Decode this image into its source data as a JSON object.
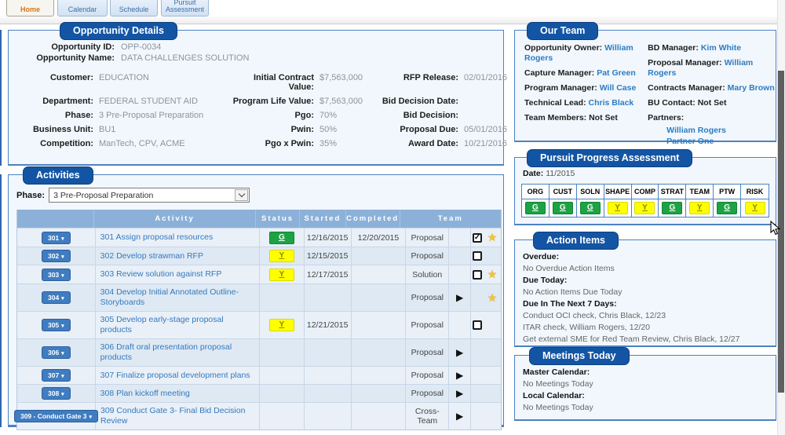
{
  "colors": {
    "accent": "#1355a4",
    "panel_border": "#4d82c2",
    "status_green": "#1ca344",
    "status_yellow": "#ffff00",
    "link": "#3579bd",
    "active_tab_text": "#d4731a"
  },
  "icons": {
    "caret_down": "▾",
    "play": "▶",
    "star": "★",
    "check": "✓",
    "chevron_down": "select-chevron"
  },
  "tabs": [
    {
      "label": "Home",
      "active": true
    },
    {
      "label": "Calendar",
      "active": false
    },
    {
      "label": "Schedule",
      "active": false
    },
    {
      "label": "Pursuit Assessment",
      "active": false
    }
  ],
  "opportunity_details": {
    "title": "Opportunity Details",
    "top_fields": [
      {
        "label": "Opportunity ID:",
        "value": "OPP-0034"
      },
      {
        "label": "Opportunity Name:",
        "value": "DATA CHALLENGES SOLUTION"
      }
    ],
    "col1": [
      {
        "label": "Customer:",
        "value": "EDUCATION"
      },
      {
        "label": "Department:",
        "value": "FEDERAL STUDENT AID"
      },
      {
        "label": "Phase:",
        "value": "3 Pre-Proposal Preparation"
      },
      {
        "label": "Business Unit:",
        "value": "BU1"
      },
      {
        "label": "Competition:",
        "value": "ManTech, CPV, ACME"
      }
    ],
    "col2": [
      {
        "label": "Initial Contract Value:",
        "value": "$7,563,000"
      },
      {
        "label": "Program Life Value:",
        "value": "$7,563,000"
      },
      {
        "label": "Pgo:",
        "value": "70%"
      },
      {
        "label": "Pwin:",
        "value": "50%"
      },
      {
        "label": "Pgo x Pwin:",
        "value": "35%"
      }
    ],
    "col3": [
      {
        "label": "RFP Release:",
        "value": "02/01/2016"
      },
      {
        "label": "Bid Decision Date:",
        "value": ""
      },
      {
        "label": "Bid Decision:",
        "value": ""
      },
      {
        "label": "Proposal Due:",
        "value": "05/01/2016"
      },
      {
        "label": "Award Date:",
        "value": "10/21/2016"
      }
    ]
  },
  "activities": {
    "title": "Activities",
    "phase_label": "Phase:",
    "phase_value": "3 Pre-Proposal Preparation",
    "columns": [
      "",
      "Activity",
      "Status",
      "Started",
      "Completed",
      "Team"
    ],
    "rows": [
      {
        "button": "301",
        "name": "301 Assign proposal resources",
        "status": "G",
        "started": "12/16/2015",
        "completed": "12/20/2015",
        "team": "Proposal",
        "play": false,
        "checkbox": "checked",
        "star": true
      },
      {
        "button": "302",
        "name": "302 Develop strawman RFP",
        "status": "Y",
        "started": "12/15/2015",
        "completed": "",
        "team": "Proposal",
        "play": false,
        "checkbox": "empty",
        "star": false
      },
      {
        "button": "303",
        "name": "303 Review solution against RFP",
        "status": "Y",
        "started": "12/17/2015",
        "completed": "",
        "team": "Solution",
        "play": false,
        "checkbox": "empty",
        "star": true
      },
      {
        "button": "304",
        "name": "304 Develop Initial Annotated Outline- Storyboards",
        "status": "",
        "started": "",
        "completed": "",
        "team": "Proposal",
        "play": true,
        "checkbox": null,
        "star": true
      },
      {
        "button": "305",
        "name": "305 Develop early-stage proposal products",
        "status": "Y",
        "started": "12/21/2015",
        "completed": "",
        "team": "Proposal",
        "play": false,
        "checkbox": "empty",
        "star": false
      },
      {
        "button": "306",
        "name": "306 Draft oral presentation proposal products",
        "status": "",
        "started": "",
        "completed": "",
        "team": "Proposal",
        "play": true,
        "checkbox": null,
        "star": false
      },
      {
        "button": "307",
        "name": "307 Finalize proposal development plans",
        "status": "",
        "started": "",
        "completed": "",
        "team": "Proposal",
        "play": true,
        "checkbox": null,
        "star": false
      },
      {
        "button": "308",
        "name": "308 Plan kickoff meeting",
        "status": "",
        "started": "",
        "completed": "",
        "team": "Proposal",
        "play": true,
        "checkbox": null,
        "star": false
      },
      {
        "button": "309 - Conduct Gate 3",
        "name": "309 Conduct Gate 3- Final Bid Decision Review",
        "status": "",
        "started": "",
        "completed": "",
        "team": "Cross-Team",
        "play": true,
        "checkbox": null,
        "star": false
      }
    ]
  },
  "our_team": {
    "title": "Our Team",
    "left": [
      {
        "label": "Opportunity Owner:",
        "value": "William Rogers",
        "link": true
      },
      {
        "label": "Capture Manager:",
        "value": "Pat Green",
        "link": true
      },
      {
        "label": "Program Manager:",
        "value": "Will Case",
        "link": true
      },
      {
        "label": "Technical Lead:",
        "value": "Chris Black",
        "link": true
      },
      {
        "label": "Team Members:",
        "value": "Not Set",
        "link": false
      }
    ],
    "right": [
      {
        "label": "BD Manager:",
        "value": "Kim White",
        "link": true
      },
      {
        "label": "Proposal Manager:",
        "value": "William Rogers",
        "link": true
      },
      {
        "label": "Contracts Manager:",
        "value": "Mary Brown",
        "link": true
      },
      {
        "label": "BU Contact:",
        "value": "Not Set",
        "link": false
      },
      {
        "label": "Partners:",
        "value": "",
        "link": false,
        "sub": [
          "William Rogers",
          "Partner One"
        ]
      }
    ]
  },
  "pursuit_progress": {
    "title": "Pursuit Progress Assessment",
    "date_label": "Date:",
    "date_value": "11/2015",
    "columns": [
      "ORG",
      "CUST",
      "SOLN",
      "SHAPE",
      "COMP",
      "STRAT",
      "TEAM",
      "PTW",
      "RISK"
    ],
    "values": [
      "G",
      "G",
      "G",
      "Y",
      "Y",
      "G",
      "Y",
      "G",
      "Y"
    ]
  },
  "action_items": {
    "title": "Action Items",
    "sections": [
      {
        "heading": "Overdue:",
        "items": [
          "No Overdue Action Items"
        ]
      },
      {
        "heading": "Due Today:",
        "items": [
          "No Action Items Due Today"
        ]
      },
      {
        "heading": "Due In The Next 7 Days:",
        "items": [
          "Conduct OCI check, Chris Black, 12/23",
          "ITAR check, William Rogers, 12/20",
          "Get external SME for Red Team Review, Chris Black, 12/27"
        ]
      }
    ]
  },
  "meetings_today": {
    "title": "Meetings Today",
    "sections": [
      {
        "heading": "Master Calendar:",
        "items": [
          "No Meetings Today"
        ]
      },
      {
        "heading": "Local Calendar:",
        "items": [
          "No Meetings Today"
        ]
      }
    ]
  }
}
